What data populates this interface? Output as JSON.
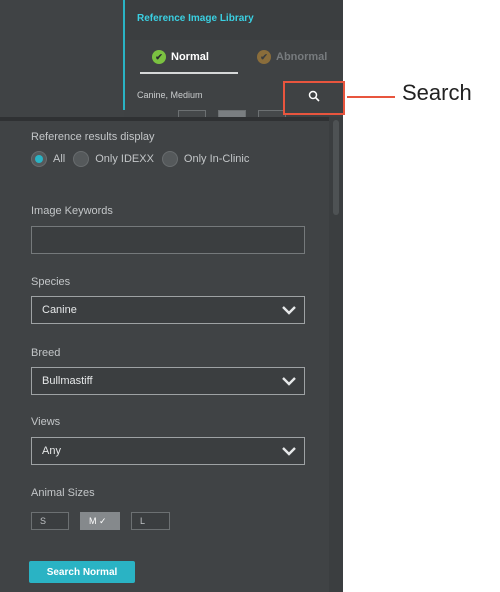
{
  "library": {
    "title": "Reference Image Library",
    "tabs": [
      {
        "label": "Normal",
        "icon": "check-circle-icon",
        "active": true
      },
      {
        "label": "Abnormal",
        "icon": "abnormal-icon",
        "active": false
      }
    ],
    "species_summary": "Canine, Medium",
    "search_icon": "search-icon"
  },
  "callout": {
    "label": "Search",
    "color": "#e8553e"
  },
  "filters": {
    "results_display": {
      "label": "Reference results display",
      "options": [
        {
          "label": "All",
          "checked": true
        },
        {
          "label": "Only IDEXX",
          "checked": false
        },
        {
          "label": "Only In-Clinic",
          "checked": false
        }
      ]
    },
    "keywords": {
      "label": "Image Keywords",
      "value": ""
    },
    "species": {
      "label": "Species",
      "value": "Canine"
    },
    "breed": {
      "label": "Breed",
      "value": "Bullmastiff"
    },
    "views": {
      "label": "Views",
      "value": "Any"
    },
    "animal_sizes": {
      "label": "Animal Sizes",
      "options": [
        {
          "label": "S",
          "selected": false
        },
        {
          "label": "M ✓",
          "selected": true
        },
        {
          "label": "L",
          "selected": false
        }
      ]
    },
    "search_button": "Search Normal"
  },
  "colors": {
    "accent": "#2ab3c4",
    "panel": "#404345",
    "normal_icon": "#7bc241"
  }
}
